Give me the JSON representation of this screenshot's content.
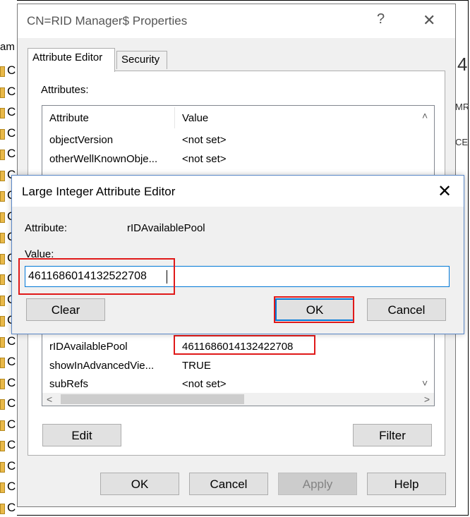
{
  "background": {
    "left_label": "am",
    "left_rows": [
      "C",
      "C",
      "C",
      "C",
      "C",
      "C",
      "C",
      "C",
      "C",
      "C",
      "C",
      "C",
      "C",
      "C",
      "C",
      "C",
      "C",
      "C",
      "C",
      "C",
      "C",
      "C"
    ],
    "right_fragments": [
      "4",
      "MR",
      "CE"
    ]
  },
  "props_dialog": {
    "title": "CN=RID Manager$ Properties",
    "help_glyph": "?",
    "close_glyph": "✕",
    "tabs": [
      "Attribute Editor",
      "Security"
    ],
    "attributes_label": "Attributes:",
    "columns": [
      "Attribute",
      "Value"
    ],
    "rows_top": [
      {
        "name": "objectVersion",
        "value": "<not set>"
      },
      {
        "name": "otherWellKnownObje...",
        "value": "<not set>"
      }
    ],
    "rows_bottom": [
      {
        "name": "rIDAvailablePool",
        "value": "4611686014132422708"
      },
      {
        "name": "showInAdvancedVie...",
        "value": "TRUE"
      },
      {
        "name": "subRefs",
        "value": "<not set>"
      }
    ],
    "edit_label": "Edit",
    "filter_label": "Filter",
    "ok_label": "OK",
    "cancel_label": "Cancel",
    "apply_label": "Apply",
    "help_label": "Help"
  },
  "integer_editor": {
    "title": "Large Integer Attribute Editor",
    "close_glyph": "✕",
    "attribute_label": "Attribute:",
    "attribute_value": "rIDAvailablePool",
    "value_label": "Value:",
    "value_input": "4611686014132522708",
    "clear_label": "Clear",
    "ok_label": "OK",
    "cancel_label": "Cancel"
  },
  "colors": {
    "highlight": "#e01919",
    "focus": "#0078d7"
  }
}
